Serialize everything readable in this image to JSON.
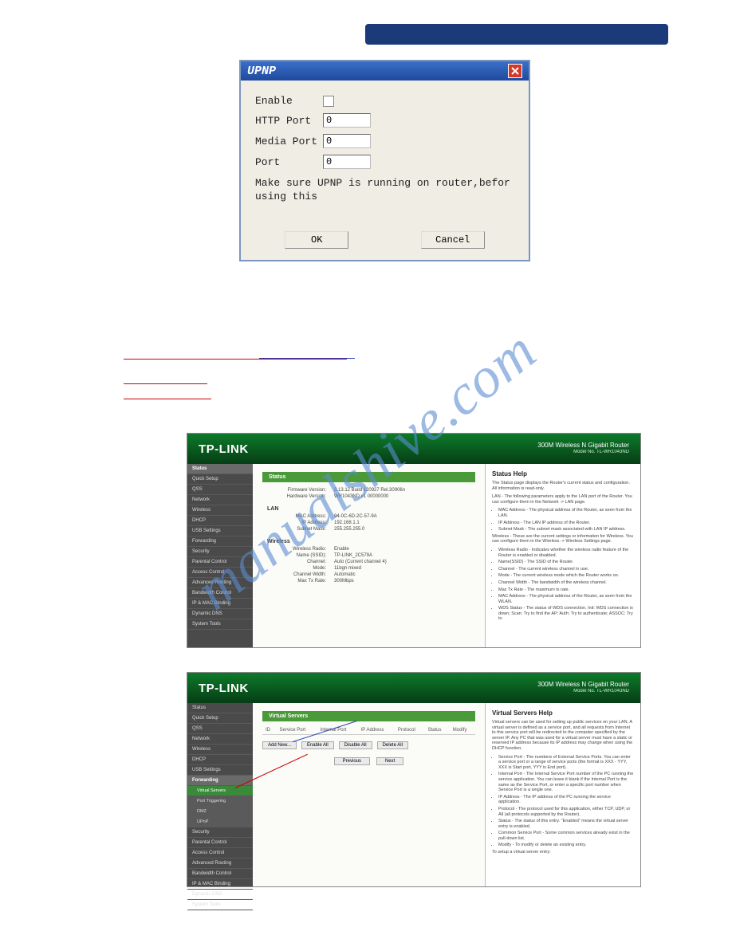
{
  "banner": {},
  "upnp": {
    "title": "UPNP",
    "enable_label": "Enable",
    "http_port_label": "HTTP Port",
    "http_port_value": "0",
    "media_port_label": "Media Port",
    "media_port_value": "0",
    "port_label": "Port",
    "port_value": "0",
    "note": "Make sure UPNP is running on router,befor using this",
    "ok_label": "OK",
    "cancel_label": "Cancel"
  },
  "watermark_text": "manualshive.com",
  "tp_common": {
    "logo": "TP-LINK",
    "model_line1": "300M Wireless N Gigabit Router",
    "model_line2": "Model No. TL-WR1043ND"
  },
  "tp1": {
    "nav": [
      "Status",
      "Quick Setup",
      "QSS",
      "Network",
      "Wireless",
      "DHCP",
      "USB Settings",
      "Forwarding",
      "Security",
      "Parental Control",
      "Access Control",
      "Advanced Routing",
      "Bandwidth Control",
      "IP & MAC Binding",
      "Dynamic DNS",
      "System Tools"
    ],
    "status_title": "Status",
    "firmware_k": "Firmware Version:",
    "firmware_v": "3.13.12 Build 120927 Rel.30906n",
    "hardware_k": "Hardware Version:",
    "hardware_v": "WR1043ND v1 00000000",
    "lan_head": "LAN",
    "lan_mac_k": "MAC Address:",
    "lan_mac_v": "94-0C-6D-2C-57-9A",
    "lan_ip_k": "IP Address:",
    "lan_ip_v": "192.168.1.1",
    "lan_mask_k": "Subnet Mask:",
    "lan_mask_v": "255.255.255.0",
    "wireless_head": "Wireless",
    "w_radio_k": "Wireless Radio:",
    "w_radio_v": "Enable",
    "w_name_k": "Name (SSID):",
    "w_name_v": "TP-LINK_2C579A",
    "w_channel_k": "Channel:",
    "w_channel_v": "Auto (Current channel 4)",
    "w_mode_k": "Mode:",
    "w_mode_v": "11bgn mixed",
    "w_width_k": "Channel Width:",
    "w_width_v": "Automatic",
    "w_max_k": "Max Tx Rate:",
    "w_max_v": "300Mbps",
    "help_title": "Status Help",
    "help_p1": "The Status page displays the Router's current status and configuration. All information is read-only.",
    "help_p2": "LAN - The following parameters apply to the LAN port of the Router. You can configure them in the Network -> LAN page.",
    "help_li1": "MAC Address - The physical address of the Router, as seen from the LAN.",
    "help_li2": "IP Address - The LAN IP address of the Router.",
    "help_li3": "Subnet Mask - The subnet mask associated with LAN IP address.",
    "help_p3": "Wireless - These are the current settings or information for Wireless. You can configure them in the Wireless -> Wireless Settings page.",
    "help_li4": "Wireless Radio - Indicates whether the wireless radio feature of the Router is enabled or disabled.",
    "help_li5": "Name(SSID) - The SSID of the Router.",
    "help_li6": "Channel - The current wireless channel in use.",
    "help_li7": "Mode - The current wireless mode which the Router works on.",
    "help_li8": "Channel Width - The bandwidth of the wireless channel.",
    "help_li9": "Max Tx Rate - The maximum tx rate.",
    "help_li10": "MAC Address - The physical address of the Router, as seen from the WLAN.",
    "help_li11": "WDS Status - The status of WDS connection. Init: WDS connection is down; Scan: Try to find the AP; Auth: Try to authenticate; ASSOC: Try to"
  },
  "tp2": {
    "nav_top": [
      "Status",
      "Quick Setup",
      "QSS",
      "Network",
      "Wireless",
      "DHCP",
      "USB Settings"
    ],
    "nav_forwarding": "Forwarding",
    "nav_sub": [
      "Virtual Servers",
      "Port Triggering",
      "DMZ",
      "UPnP"
    ],
    "nav_bottom": [
      "Security",
      "Parental Control",
      "Access Control",
      "Advanced Routing",
      "Bandwidth Control",
      "IP & MAC Binding",
      "Dynamic DNS",
      "System Tools"
    ],
    "vs_title": "Virtual Servers",
    "th_id": "ID",
    "th_sp": "Service Port",
    "th_ip2": "Internal Port",
    "th_ip": "IP Address",
    "th_proto": "Protocol",
    "th_status": "Status",
    "th_modify": "Modify",
    "btn_addnew": "Add New...",
    "btn_enableall": "Enable All",
    "btn_disableall": "Disable All",
    "btn_deleteall": "Delete All",
    "btn_prev": "Previous",
    "btn_next": "Next",
    "help_title": "Virtual Servers Help",
    "help_p1": "Virtual servers can be used for setting up public services on your LAN. A virtual server is defined as a service port, and all requests from Internet to this service port will be redirected to the computer specified by the server IP. Any PC that was used for a virtual server must have a static or reserved IP address because its IP address may change when using the DHCP function.",
    "help_li1": "Service Port - The numbers of External Service Ports. You can enter a service port or a range of service ports (the format is XXX - YYY, XXX is Start port, YYY is End port).",
    "help_li2": "Internal Port - The Internal Service Port number of the PC running the service application. You can leave it blank if the Internal Port is the same as the Service Port, or enter a specific port number when Service Port is a single one.",
    "help_li3": "IP Address - The IP address of the PC running the service application.",
    "help_li4": "Protocol - The protocol used for this application, either TCP, UDP, or All (all protocols supported by the Router).",
    "help_li5": "Status - The status of this entry. \"Enabled\" means the virtual server entry is enabled.",
    "help_li6": "Common Service Port - Some common services already exist in the pull-down list.",
    "help_li7": "Modify - To modify or delete an existing entry.",
    "help_p2": "To setup a virtual server entry:"
  }
}
